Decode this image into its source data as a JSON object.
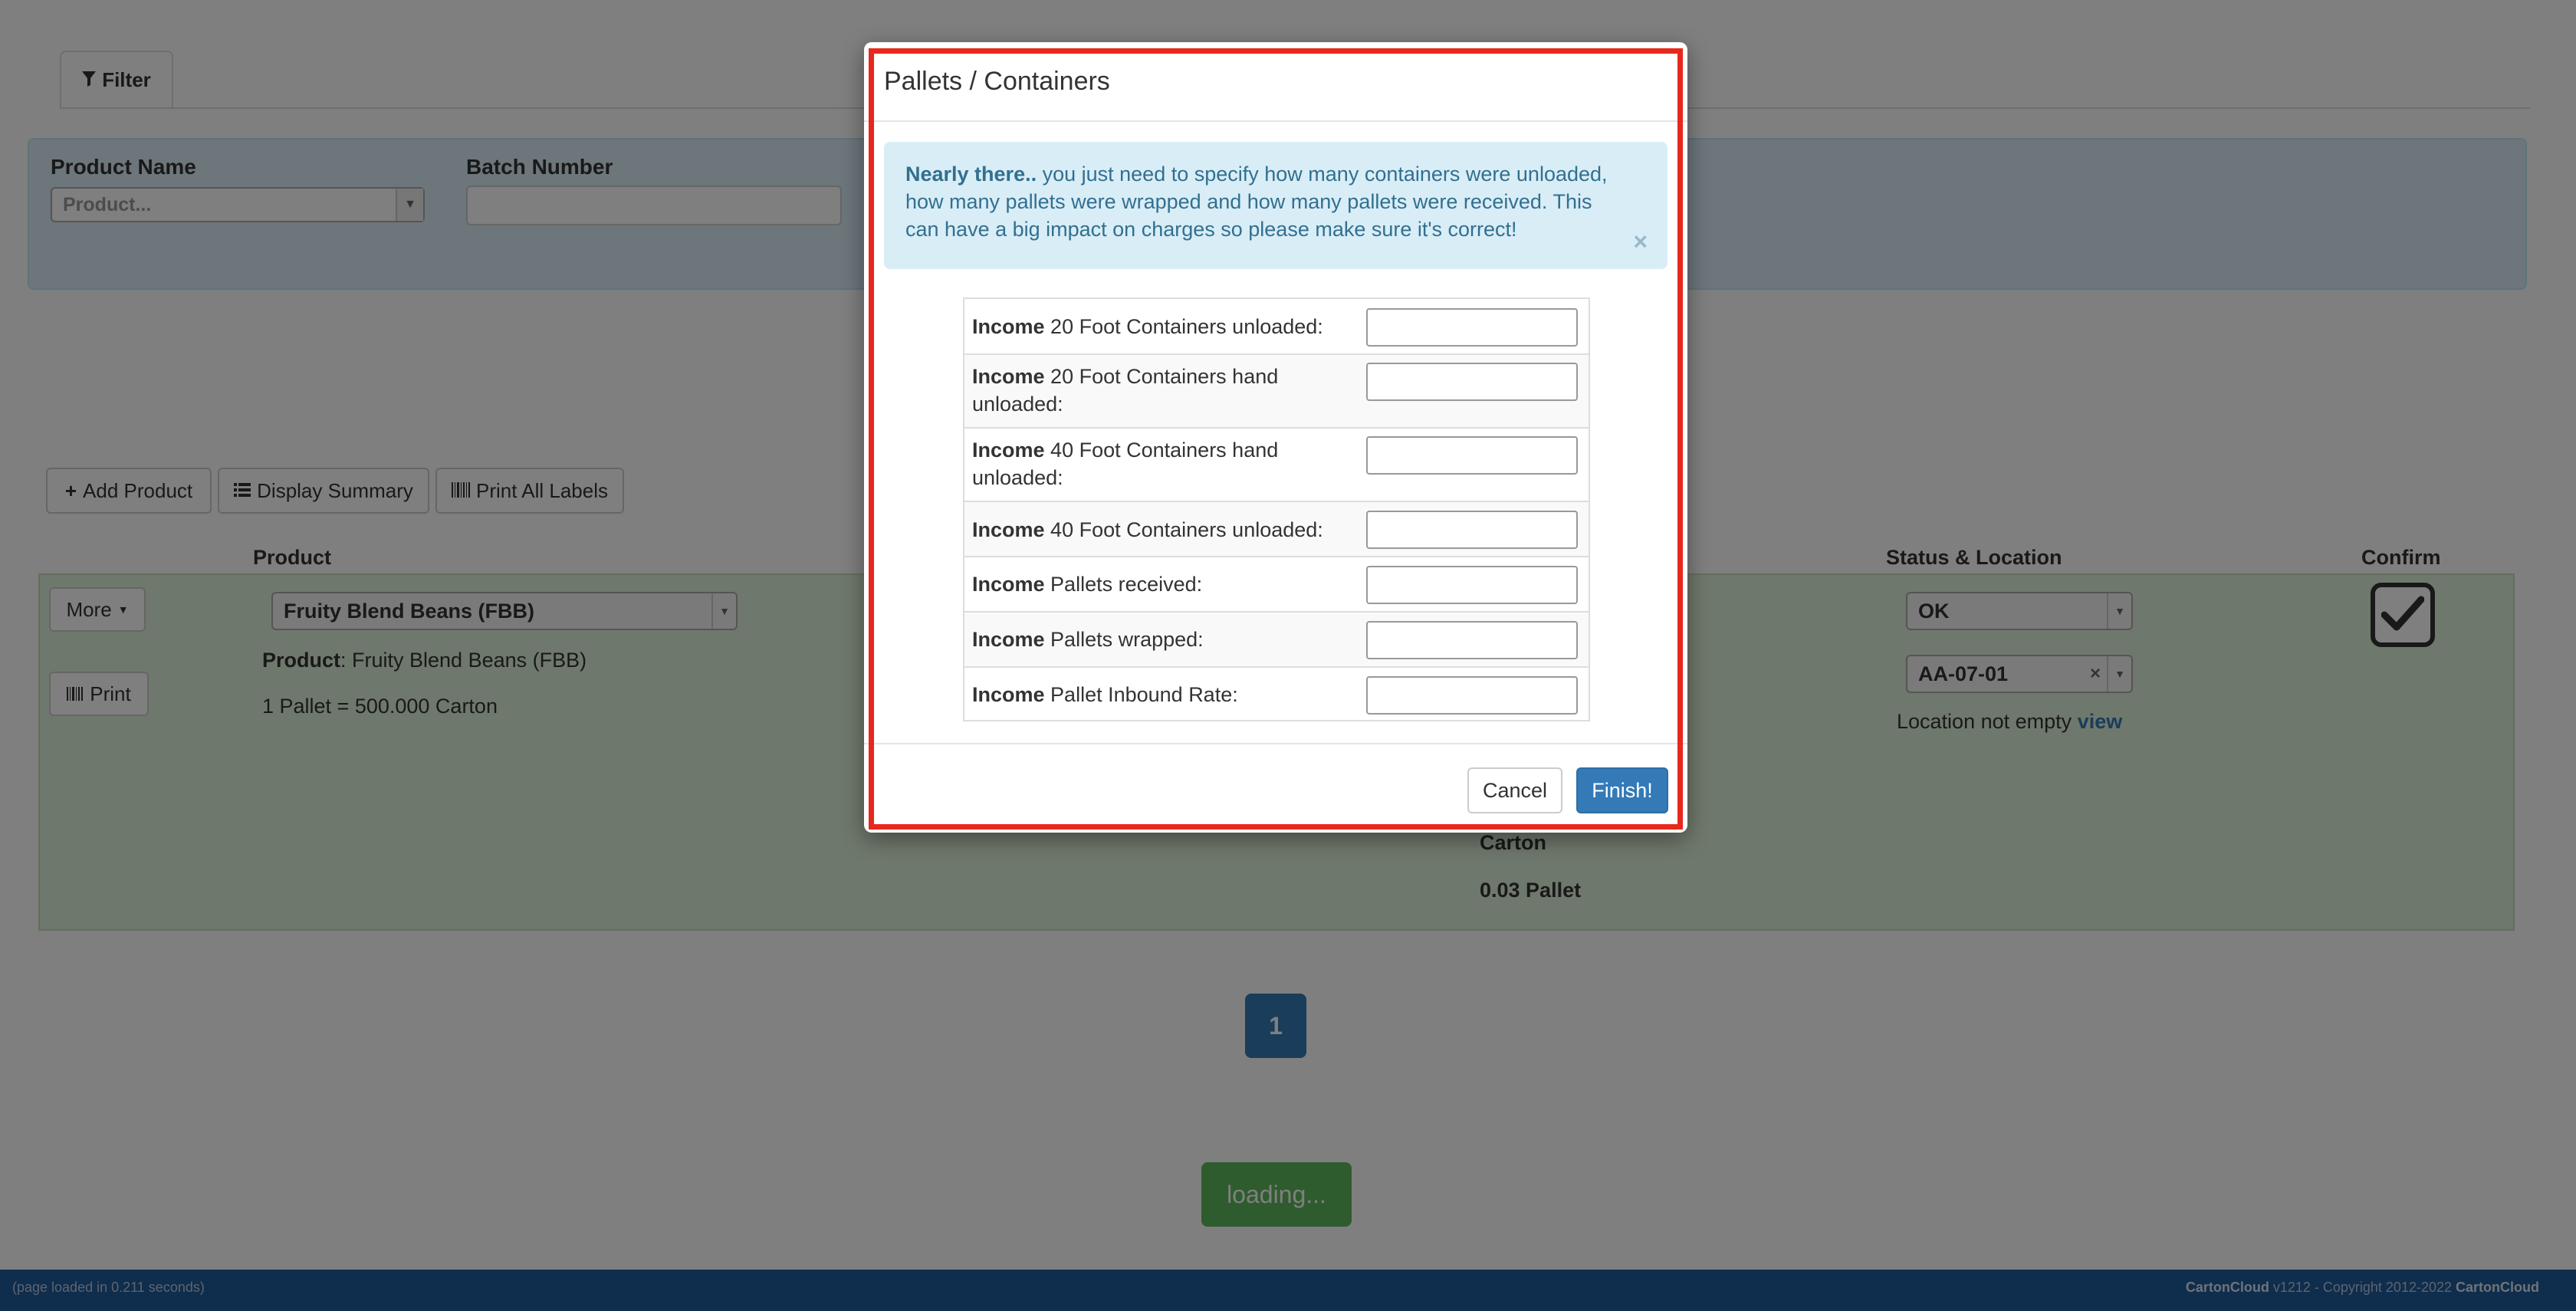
{
  "filter": {
    "tab_label": "Filter",
    "product_name_label": "Product Name",
    "product_placeholder": "Product...",
    "batch_number_label": "Batch Number",
    "batch_number_value": ""
  },
  "toolbar": {
    "add_product": "Add Product",
    "display_summary": "Display Summary",
    "print_all_labels": "Print All Labels"
  },
  "table": {
    "headers": {
      "product": "Product",
      "status_location": "Status & Location",
      "confirm": "Confirm"
    },
    "row": {
      "more_button": "More",
      "print_button": "Print",
      "product_select": "Fruity Blend Beans (FBB)",
      "product_label": "Product",
      "product_value": ": Fruity Blend Beans (FBB)",
      "pallet_conversion": "1 Pallet = 500.000 Carton",
      "qty_unit": "Carton",
      "qty_pallets": "0.03 Pallet",
      "status_select": "OK",
      "location_select": "AA-07-01",
      "location_note": "Location not empty",
      "location_view_link": "view",
      "confirmed": true
    }
  },
  "pagination": {
    "current_page": "1"
  },
  "loading_button": "loading...",
  "footer": {
    "load_time": "(page loaded in 0.211 seconds)",
    "brand": "CartonCloud",
    "version_text": " v1212 - Copyright 2012-2022 ",
    "brand2": "CartonCloud"
  },
  "modal": {
    "title": "Pallets / Containers",
    "alert_bold": "Nearly there..",
    "alert_text": " you just need to specify how many containers were unloaded, how many pallets were wrapped and how many pallets were received. This can have a big impact on charges so please make sure it's correct!",
    "alert_close": "×",
    "income_prefix": "Income",
    "rows": [
      {
        "label": "20 Foot Containers unloaded:",
        "value": ""
      },
      {
        "label": "20 Foot Containers hand unloaded:",
        "value": ""
      },
      {
        "label": "40 Foot Containers hand unloaded:",
        "value": ""
      },
      {
        "label": "40 Foot Containers unloaded:",
        "value": ""
      },
      {
        "label": "Pallets received:",
        "value": ""
      },
      {
        "label": "Pallets wrapped:",
        "value": ""
      },
      {
        "label": "Pallet Inbound Rate:",
        "value": ""
      }
    ],
    "cancel_button": "Cancel",
    "finish_button": "Finish!"
  },
  "colors": {
    "primary": "#337ab7",
    "success_bg": "#dff0d8",
    "info_bg": "#d9edf7",
    "highlight_outline": "#e8281c",
    "footer_bg": "#1f5a9a"
  }
}
